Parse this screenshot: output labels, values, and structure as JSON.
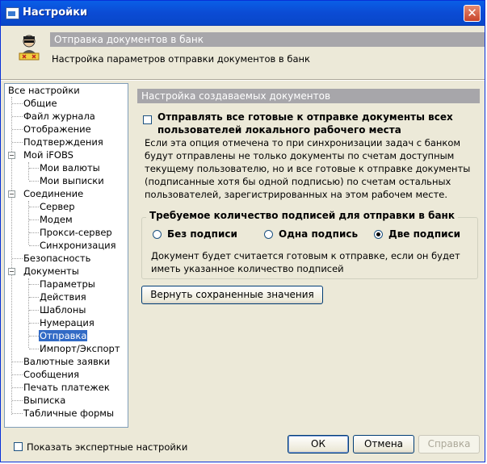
{
  "window": {
    "title": "Настройки"
  },
  "header": {
    "title": "Отправка документов в банк",
    "subtitle": "Настройка параметров отправки документов в банк"
  },
  "tree": {
    "items": [
      {
        "label": "Все настройки"
      },
      {
        "label": "Общие"
      },
      {
        "label": "Файл журнала"
      },
      {
        "label": "Отображение"
      },
      {
        "label": "Подтверждения"
      },
      {
        "label": "Мой iFOBS"
      },
      {
        "label": "Мои валюты"
      },
      {
        "label": "Мои выписки"
      },
      {
        "label": "Соединение"
      },
      {
        "label": "Сервер"
      },
      {
        "label": "Модем"
      },
      {
        "label": "Прокси-сервер"
      },
      {
        "label": "Синхронизация"
      },
      {
        "label": "Безопасность"
      },
      {
        "label": "Документы"
      },
      {
        "label": "Параметры"
      },
      {
        "label": "Действия"
      },
      {
        "label": "Шаблоны"
      },
      {
        "label": "Нумерация"
      },
      {
        "label": "Отправка"
      },
      {
        "label": "Импорт/Экспорт"
      },
      {
        "label": "Валютные заявки"
      },
      {
        "label": "Сообщения"
      },
      {
        "label": "Печать платежек"
      },
      {
        "label": "Выписка"
      },
      {
        "label": "Табличные формы"
      }
    ]
  },
  "panel": {
    "section_title": "Настройка создаваемых документов",
    "send_all_label": "Отправлять все готовые к отправке документы всех пользователей локального рабочего места",
    "description": "Если эта опция отмечена то при синхронизации задач с банком будут отправлены не только документы по счетам доступным текущему пользователю, но и все готовые к отправке документы (подписанные хотя бы одной подписью) по счетам остальных пользователей, зарегистрированных на этом рабочем месте.",
    "signatures_group": {
      "legend": "Требуемое количество подписей для отправки в банк",
      "options": [
        "Без подписи",
        "Одна подпись",
        "Две подписи"
      ],
      "selected": "Две подписи",
      "note": "Документ будет считается готовым к отправке, если он будет иметь указанное количество подписей"
    },
    "restore_button": "Вернуть сохраненные значения"
  },
  "footer": {
    "expert_label": "Показать экспертные настройки",
    "ok": "ОК",
    "cancel": "Отмена",
    "apply": "Справка"
  },
  "colors": {
    "title_bar": "#0b4bd4",
    "section_bar": "#a7a6aa",
    "selection": "#316ac5",
    "dialog_bg": "#ece9d8"
  }
}
